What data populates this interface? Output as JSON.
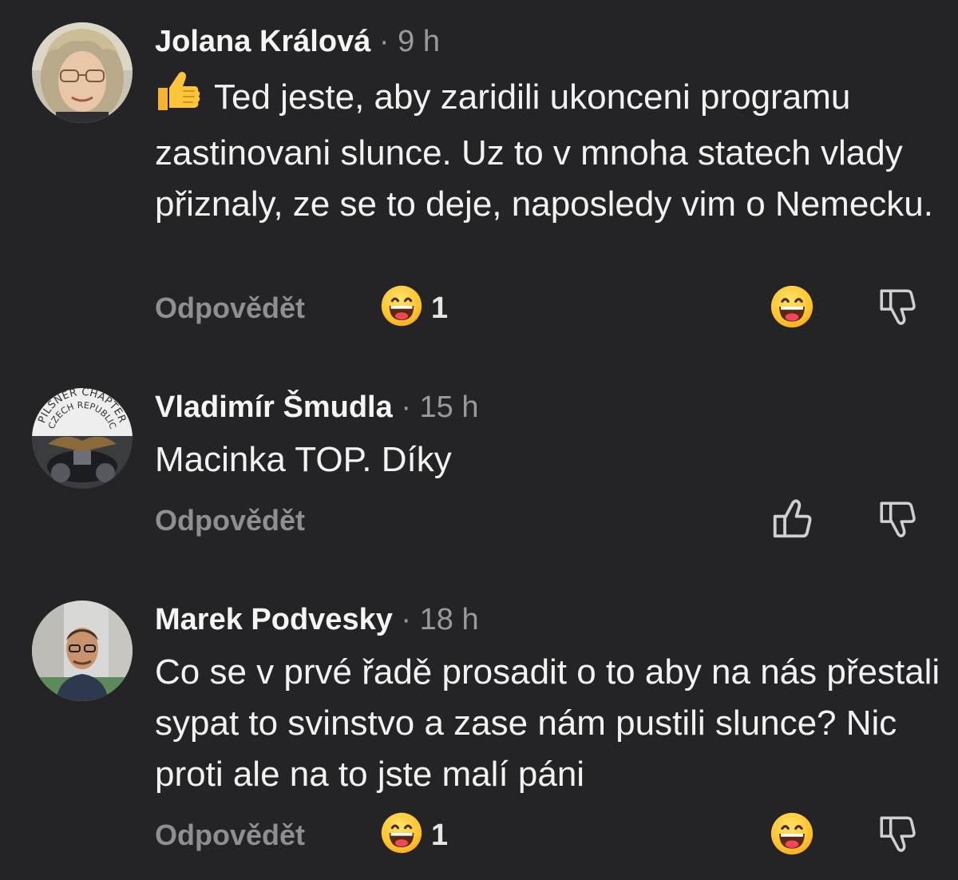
{
  "comments": [
    {
      "author": "Jolana Králová",
      "separator": "·",
      "time": "9 h",
      "text": "Ted jeste, aby zaridili ukonceni programu zastinovani slunce. Uz to v mnoha statech vlady přiznaly, ze se to deje, naposledy vim o Nemecku.",
      "lead_emoji": "thumbs-up-emoji",
      "reply_label": "Odpovědět",
      "reaction_count": "1",
      "reaction_emoji": "grinning-face-emoji",
      "avatar": "woman-with-glasses"
    },
    {
      "author": "Vladimír Šmudla",
      "separator": "·",
      "time": "15 h",
      "text": "Macinka TOP. Díky",
      "reply_label": "Odpovědět",
      "avatar": "pilsner-chapter-czech-republic-logo",
      "avatar_text_line1": "PILSNER CHAPTER",
      "avatar_text_line2": "CZECH REPUBLIC"
    },
    {
      "author": "Marek Podvesky",
      "separator": "·",
      "time": "18 h",
      "text": "Co se v prvé řadě prosadit o to aby na nás přestali sypat to svinstvo a zase nám pustili slunce? Nic proti ale na to jste malí páni",
      "reply_label": "Odpovědět",
      "reaction_count": "1",
      "reaction_emoji": "grinning-face-emoji",
      "avatar": "man-with-glasses"
    }
  ],
  "colors": {
    "background": "#242426",
    "author": "#f5f5f5",
    "meta": "#9a9a9e",
    "reply": "#8e8e93",
    "icon": "#d0d0d4",
    "emoji_yellow": "#ffcc33"
  }
}
